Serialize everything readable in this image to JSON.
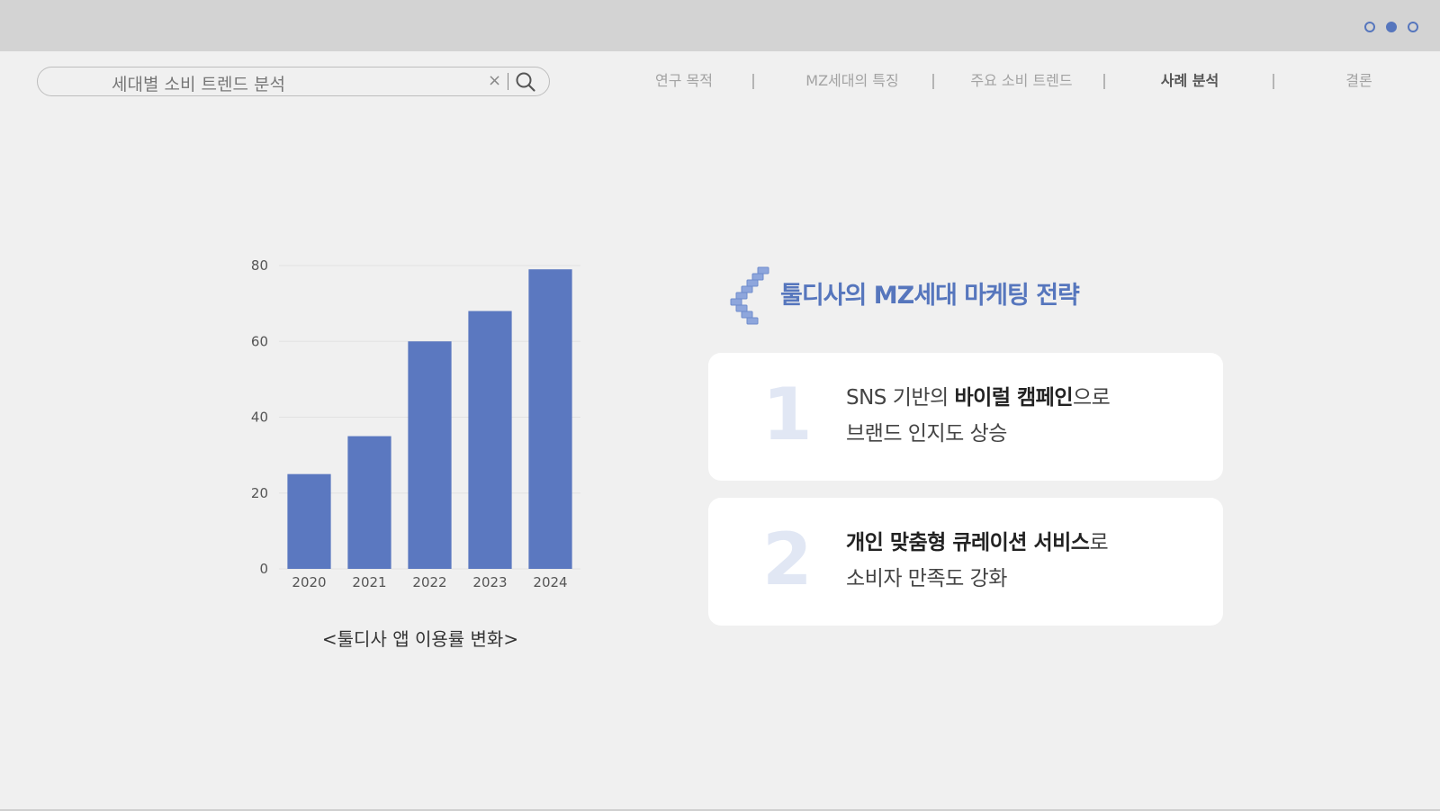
{
  "header": {
    "page_indicator": {
      "count": 3,
      "active_index": 1
    }
  },
  "search": {
    "value": "세대별 소비 트렌드 분석",
    "clear_symbol": "×"
  },
  "nav": {
    "items": [
      {
        "label": "연구 목적",
        "active": false
      },
      {
        "label": "MZ세대의 특징",
        "active": false
      },
      {
        "label": "주요 소비 트렌드",
        "active": false
      },
      {
        "label": "사례 분석",
        "active": true
      },
      {
        "label": "결론",
        "active": false
      }
    ]
  },
  "chart_data": {
    "type": "bar",
    "categories": [
      "2020",
      "2021",
      "2022",
      "2023",
      "2024"
    ],
    "values": [
      25,
      35,
      60,
      68,
      79
    ],
    "ylim": [
      0,
      80
    ],
    "yticks": [
      0,
      20,
      40,
      60,
      80
    ],
    "grid": true,
    "bar_color": "#5b78c0",
    "caption": "<툴디사 앱 이용률 변화>"
  },
  "strategy": {
    "title": "툴디사의 MZ세대 마케팅 전략",
    "accent_color": "#5676bd",
    "icon": "stairs-icon",
    "cards": [
      {
        "number": "1",
        "line1_prefix": "SNS 기반의 ",
        "line1_bold": "바이럴 캠페인",
        "line1_suffix": "으로",
        "line2": "브랜드 인지도 상승"
      },
      {
        "number": "2",
        "line1_prefix": "",
        "line1_bold": "개인 맞춤형 큐레이션 서비스",
        "line1_suffix": "로",
        "line2": "소비자 만족도 강화"
      }
    ]
  }
}
